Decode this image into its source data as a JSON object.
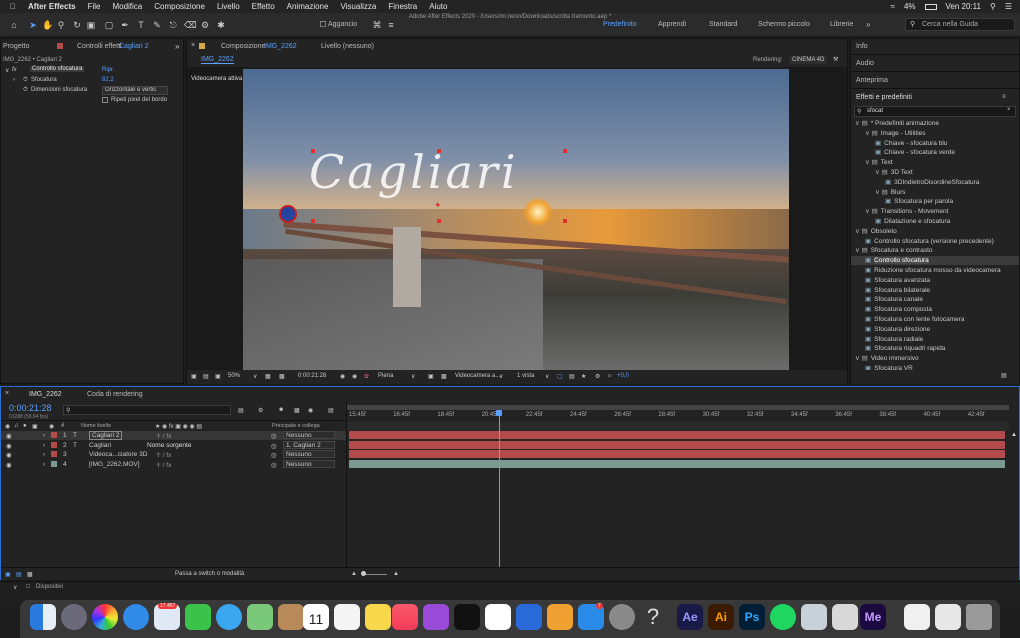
{
  "menubar": {
    "app": "After Effects",
    "items": [
      "File",
      "Modifica",
      "Composizione",
      "Livello",
      "Effetto",
      "Animazione",
      "Visualizza",
      "Finestra",
      "Aiuto"
    ],
    "battery": "4%",
    "clock": "Ven 20:11"
  },
  "toolbar": {
    "title": "Adobe After Effects 2020 - /Users/mr.neon/Downloads/scritta tramonto.aep *",
    "snap_label": "Aggancio",
    "workspaces": [
      "Predefinito",
      "Apprendi",
      "Standard",
      "Schermo piccolo",
      "Librerie"
    ],
    "search_placeholder": "Cerca nella Guida"
  },
  "left_panel": {
    "tab_project": "Progetto",
    "tab_effects": "Controlli effetti",
    "tab_effects_layer": "Cagliari 2",
    "breadcrumb": "IMG_2262 • Cagliari 2",
    "effect_name": "Controllo sfocatura",
    "reset": "Ripr.",
    "props": [
      {
        "label": "Sfocatura",
        "value": "82,2"
      },
      {
        "label": "Dimensioni sfocatura",
        "value": "Orizzontale e vertic"
      }
    ],
    "checkbox_label": "Ripeti pixel del bordo"
  },
  "comp_panel": {
    "tab_label": "Composizione",
    "tab_comp": "IMG_2262",
    "layer_tab": "Livello (nessuno)",
    "subtab": "IMG_2262",
    "renderer_label": "Rendering:",
    "renderer": "CINEMA 4D",
    "camera_label": "Videocamera attiva",
    "overlay_text": "Cagliari",
    "zoom": "50%",
    "timecode": "0:00:21:28",
    "resolution": "Piena",
    "camera": "Videocamera a...",
    "views": "1 vista",
    "exposure": "+0,0"
  },
  "right_panel": {
    "info": "Info",
    "audio": "Audio",
    "preview": "Anteprima",
    "effects": "Effetti e predefiniti",
    "search": "sfocat",
    "tree": [
      {
        "label": "* Predefiniti animazione",
        "level": 0,
        "type": "folder"
      },
      {
        "label": "Image - Utilities",
        "level": 1,
        "type": "folder"
      },
      {
        "label": "Chiave - sfocatura blu",
        "level": 2,
        "type": "item"
      },
      {
        "label": "Chiave - sfocatura verde",
        "level": 2,
        "type": "item"
      },
      {
        "label": "Text",
        "level": 1,
        "type": "folder"
      },
      {
        "label": "3D Text",
        "level": 2,
        "type": "folder"
      },
      {
        "label": "3DIndietroDisordineSfocatura",
        "level": 3,
        "type": "item"
      },
      {
        "label": "Blurs",
        "level": 2,
        "type": "folder"
      },
      {
        "label": "Sfocatura per parola",
        "level": 3,
        "type": "item"
      },
      {
        "label": "Transitions - Movement",
        "level": 1,
        "type": "folder"
      },
      {
        "label": "Dilatazione e sfocatura",
        "level": 2,
        "type": "item"
      },
      {
        "label": "Obsoleto",
        "level": 0,
        "type": "folder"
      },
      {
        "label": "Controllo sfocatura (versione precedente)",
        "level": 1,
        "type": "item"
      },
      {
        "label": "Sfocatura e contrasto",
        "level": 0,
        "type": "folder"
      },
      {
        "label": "Controllo sfocatura",
        "level": 1,
        "type": "item",
        "selected": true
      },
      {
        "label": "Riduzione sfocatura mosso da videocamera",
        "level": 1,
        "type": "item"
      },
      {
        "label": "Sfocatura avanzata",
        "level": 1,
        "type": "item"
      },
      {
        "label": "Sfocatura bilaterale",
        "level": 1,
        "type": "item"
      },
      {
        "label": "Sfocatura canale",
        "level": 1,
        "type": "item"
      },
      {
        "label": "Sfocatura composta",
        "level": 1,
        "type": "item"
      },
      {
        "label": "Sfocatura con lente fotocamera",
        "level": 1,
        "type": "item"
      },
      {
        "label": "Sfocatura direzione",
        "level": 1,
        "type": "item"
      },
      {
        "label": "Sfocatura radiale",
        "level": 1,
        "type": "item"
      },
      {
        "label": "Sfocatura riquadri rapida",
        "level": 1,
        "type": "item"
      },
      {
        "label": "Video immersivo",
        "level": 0,
        "type": "folder"
      },
      {
        "label": "Sfocatura VR",
        "level": 1,
        "type": "item"
      }
    ]
  },
  "timeline": {
    "tab": "IMG_2262",
    "render_tab": "Coda di rendering",
    "timecode": "0:00:21:28",
    "frames": "01288 (59.94 fps)",
    "col_layer": "Nome livello",
    "col_parent": "Principale e collega",
    "layers": [
      {
        "num": "1",
        "type": "T",
        "name": "Cagliari 2",
        "parent": "Nessuno",
        "color": "#b44a4a"
      },
      {
        "num": "2",
        "type": "T",
        "name": "Cagliari",
        "extra": "Nome sorgente",
        "parent": "1. Cagliari 2",
        "color": "#b44a4a"
      },
      {
        "num": "3",
        "type": "",
        "name": "Videoca...ciatore 3D",
        "parent": "Nessuno",
        "color": "#b44a4a"
      },
      {
        "num": "4",
        "type": "",
        "name": "[IMG_2262.MOV]",
        "parent": "Nessuno",
        "color": "#7a9a90"
      }
    ],
    "ticks": [
      "15:45f",
      "16:45f",
      "18:45f",
      "20:45f",
      "22:45f",
      "24:45f",
      "26:45f",
      "28:45f",
      "30:45f",
      "32:45f",
      "34:45f",
      "36:45f",
      "38:45f",
      "40:45f",
      "42:45f"
    ],
    "playhead_fraction": 0.23,
    "switch_label": "Passa a switch o modalità"
  },
  "devices": {
    "label": "Dispositivi"
  },
  "dock": {
    "badge_photos": "17.457",
    "badge_appstore": "7",
    "icons": [
      "finder",
      "launchpad",
      "photos",
      "safari",
      "mail",
      "facetime",
      "messages",
      "maps",
      "contacts",
      "calendar",
      "reminders",
      "notes",
      "music",
      "podcasts",
      "tv",
      "numbers",
      "keynote",
      "pages",
      "appstore",
      "preferences",
      "help",
      "after-effects",
      "illustrator",
      "photoshop",
      "spotify",
      "finder-window",
      "media-encoder",
      "downloads",
      "trash"
    ],
    "ae": "Ae",
    "ai": "Ai",
    "ps": "Ps",
    "me": "Me",
    "calendar_day": "11"
  }
}
